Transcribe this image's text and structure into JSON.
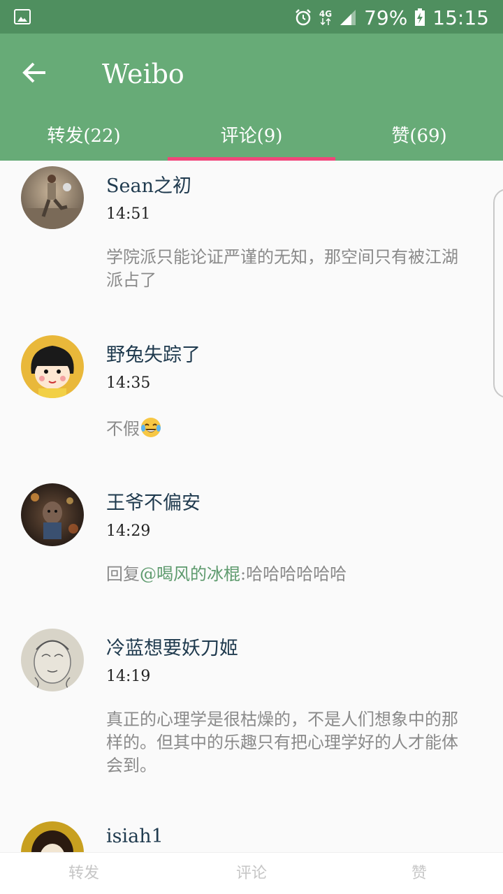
{
  "status_bar": {
    "network": "4G",
    "battery": "79%",
    "time": "15:15",
    "icons": [
      "gallery-icon",
      "alarm-icon",
      "signal-icon",
      "battery-charging-icon"
    ]
  },
  "app_bar": {
    "title": "Weibo",
    "back_icon": "arrow-left-icon",
    "background": "#67ab77",
    "tabs": [
      {
        "label": "转发(22)",
        "active": false
      },
      {
        "label": "评论(9)",
        "active": true
      },
      {
        "label": "赞(69)",
        "active": false
      }
    ],
    "indicator_color": "#f0467a"
  },
  "comments": [
    {
      "name": "Sean之初",
      "time": "14:51",
      "text": "学院派只能论证严谨的无知，那空间只有被江湖派占了"
    },
    {
      "name": "野兔失踪了",
      "time": "14:35",
      "text": "不假",
      "emoji": "laughing-tears-emoji"
    },
    {
      "name": "王爷不偏安",
      "time": "14:29",
      "reply_prefix": "回复",
      "mention": "@喝风的冰棍",
      "text": ":哈哈哈哈哈哈"
    },
    {
      "name": "冷蓝想要妖刀姬",
      "time": "14:19",
      "text": "真正的心理学是很枯燥的，不是人们想象中的那样的。但其中的乐趣只有把心理学好的人才能体会到。"
    },
    {
      "name": "isiah1",
      "time": "",
      "text": ""
    }
  ],
  "bottom_bar": {
    "items": [
      "转发",
      "评论",
      "赞"
    ]
  },
  "colors": {
    "status_bar": "#4f8f5f",
    "mention": "#5d9a6d",
    "name": "#1f3a4e",
    "comment": "#8a8a8a"
  }
}
